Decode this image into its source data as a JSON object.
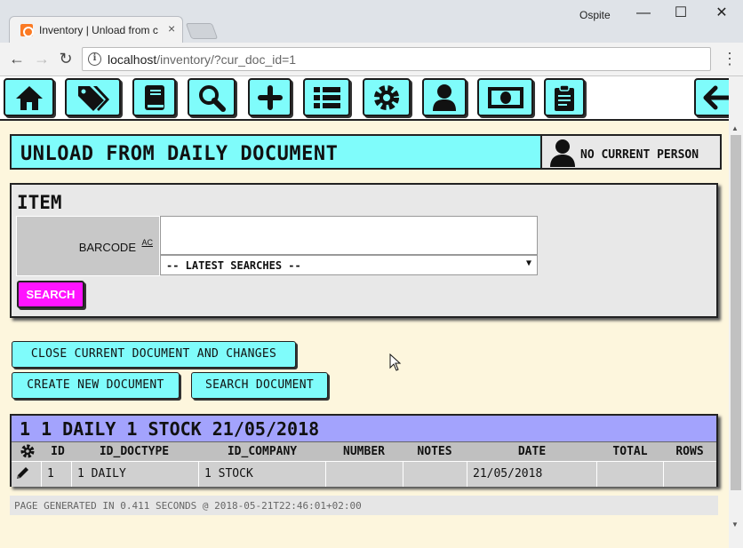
{
  "browser": {
    "tab_title": "Inventory | Unload from c",
    "profile_name": "Ospite",
    "url_host": "localhost",
    "url_rest": "/inventory/?cur_doc_id=1"
  },
  "toolbar": {
    "icons": [
      "home-icon",
      "tags-icon",
      "book-icon",
      "search-icon",
      "plus-icon",
      "list-icon",
      "gear-icon",
      "user-icon",
      "money-icon",
      "clipboard-icon",
      "arrow-left-icon"
    ],
    "accent": "#7ffcfb"
  },
  "header": {
    "title": "UNLOAD FROM DAILY DOCUMENT",
    "person_label": "NO CURRENT PERSON"
  },
  "item_panel": {
    "title": "ITEM",
    "barcode_label": "BARCODE",
    "barcode_ac": "AC",
    "barcode_value": "",
    "latest_searches": "-- LATEST SEARCHES --",
    "search_button": "SEARCH",
    "search_button_color": "#ff14ff"
  },
  "actions": {
    "close_document": "CLOSE CURRENT DOCUMENT AND CHANGES",
    "create_document": "CREATE NEW DOCUMENT",
    "search_document": "SEARCH DOCUMENT"
  },
  "document_table": {
    "title": "1 1 DAILY 1 STOCK 21/05/2018",
    "columns": [
      "ID",
      "ID_DOCTYPE",
      "ID_COMPANY",
      "NUMBER",
      "NOTES",
      "DATE",
      "TOTAL",
      "ROWS"
    ],
    "rows": [
      {
        "id": "1",
        "id_doctype": "1 DAILY",
        "id_company": "1 STOCK",
        "number": "",
        "notes": "",
        "date": "21/05/2018",
        "total": "",
        "rows": ""
      }
    ],
    "header_color": "#a3a3fd"
  },
  "footer": {
    "text": "PAGE GENERATED IN 0.411 SECONDS @ 2018-05-21T22:46:01+02:00"
  }
}
